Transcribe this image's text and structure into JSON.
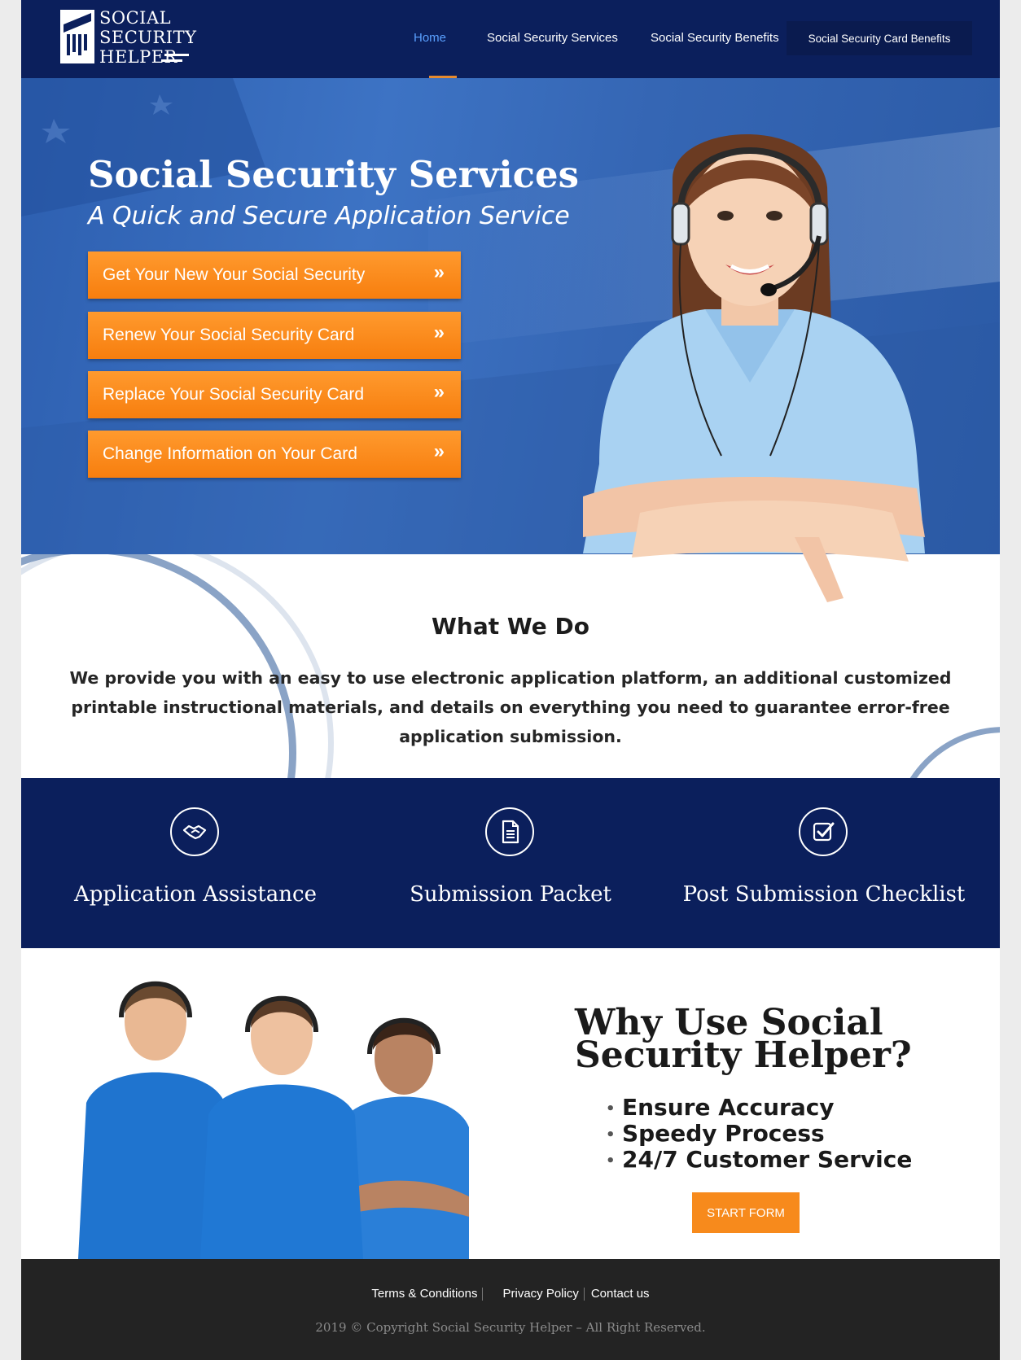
{
  "logo": {
    "line1": "SOCIAL",
    "line2": "SECURITY",
    "line3": "HELPER"
  },
  "nav": {
    "home": "Home",
    "services": "Social Security Services",
    "benefits": "Social Security Benefits",
    "card_benefits": "Social Security Card Benefits"
  },
  "hero": {
    "title": "Social Security Services",
    "subtitle": "A Quick and Secure Application Service",
    "buttons": [
      "Get Your New Your Social Security",
      "Renew Your Social Security Card",
      "Replace Your Social Security Card",
      "Change Information on Your Card"
    ],
    "chevron": "»"
  },
  "what_we_do": {
    "title": "What We Do",
    "text": "We provide you with an easy to use electronic application platform, an additional customized printable instructional materials, and details on everything you need to guarantee error-free application submission."
  },
  "features": [
    {
      "label": "Application Assistance",
      "icon": "handshake-icon"
    },
    {
      "label": "Submission Packet",
      "icon": "document-icon"
    },
    {
      "label": "Post Submission Checklist",
      "icon": "checklist-icon"
    }
  ],
  "why": {
    "title": "Why Use Social Security Helper?",
    "items": [
      "Ensure Accuracy",
      "Speedy Process",
      "24/7 Customer Service"
    ],
    "button": "START FORM"
  },
  "footer": {
    "links": [
      "Terms & Conditions",
      "Privacy Policy",
      "Contact us"
    ],
    "copyright": "2019 © Copyright Social Security Helper – All Right Reserved."
  },
  "colors": {
    "navy": "#0b1f5c",
    "orange": "#f78a1c",
    "hero_blue": "#3566b4",
    "footer": "#232323"
  }
}
